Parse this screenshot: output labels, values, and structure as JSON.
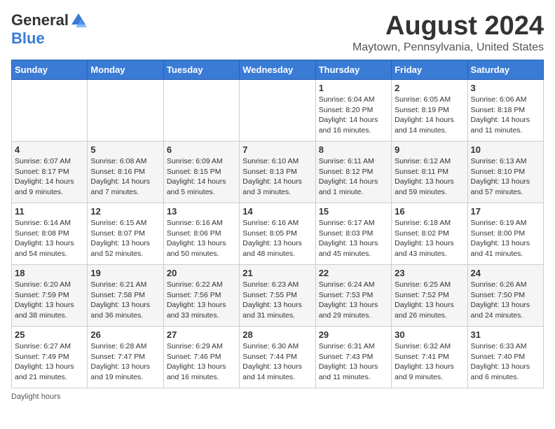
{
  "header": {
    "logo_general": "General",
    "logo_blue": "Blue",
    "month_title": "August 2024",
    "location": "Maytown, Pennsylvania, United States"
  },
  "weekdays": [
    "Sunday",
    "Monday",
    "Tuesday",
    "Wednesday",
    "Thursday",
    "Friday",
    "Saturday"
  ],
  "weeks": [
    [
      {
        "day": "",
        "info": ""
      },
      {
        "day": "",
        "info": ""
      },
      {
        "day": "",
        "info": ""
      },
      {
        "day": "",
        "info": ""
      },
      {
        "day": "1",
        "info": "Sunrise: 6:04 AM\nSunset: 8:20 PM\nDaylight: 14 hours\nand 16 minutes."
      },
      {
        "day": "2",
        "info": "Sunrise: 6:05 AM\nSunset: 8:19 PM\nDaylight: 14 hours\nand 14 minutes."
      },
      {
        "day": "3",
        "info": "Sunrise: 6:06 AM\nSunset: 8:18 PM\nDaylight: 14 hours\nand 11 minutes."
      }
    ],
    [
      {
        "day": "4",
        "info": "Sunrise: 6:07 AM\nSunset: 8:17 PM\nDaylight: 14 hours\nand 9 minutes."
      },
      {
        "day": "5",
        "info": "Sunrise: 6:08 AM\nSunset: 8:16 PM\nDaylight: 14 hours\nand 7 minutes."
      },
      {
        "day": "6",
        "info": "Sunrise: 6:09 AM\nSunset: 8:15 PM\nDaylight: 14 hours\nand 5 minutes."
      },
      {
        "day": "7",
        "info": "Sunrise: 6:10 AM\nSunset: 8:13 PM\nDaylight: 14 hours\nand 3 minutes."
      },
      {
        "day": "8",
        "info": "Sunrise: 6:11 AM\nSunset: 8:12 PM\nDaylight: 14 hours\nand 1 minute."
      },
      {
        "day": "9",
        "info": "Sunrise: 6:12 AM\nSunset: 8:11 PM\nDaylight: 13 hours\nand 59 minutes."
      },
      {
        "day": "10",
        "info": "Sunrise: 6:13 AM\nSunset: 8:10 PM\nDaylight: 13 hours\nand 57 minutes."
      }
    ],
    [
      {
        "day": "11",
        "info": "Sunrise: 6:14 AM\nSunset: 8:08 PM\nDaylight: 13 hours\nand 54 minutes."
      },
      {
        "day": "12",
        "info": "Sunrise: 6:15 AM\nSunset: 8:07 PM\nDaylight: 13 hours\nand 52 minutes."
      },
      {
        "day": "13",
        "info": "Sunrise: 6:16 AM\nSunset: 8:06 PM\nDaylight: 13 hours\nand 50 minutes."
      },
      {
        "day": "14",
        "info": "Sunrise: 6:16 AM\nSunset: 8:05 PM\nDaylight: 13 hours\nand 48 minutes."
      },
      {
        "day": "15",
        "info": "Sunrise: 6:17 AM\nSunset: 8:03 PM\nDaylight: 13 hours\nand 45 minutes."
      },
      {
        "day": "16",
        "info": "Sunrise: 6:18 AM\nSunset: 8:02 PM\nDaylight: 13 hours\nand 43 minutes."
      },
      {
        "day": "17",
        "info": "Sunrise: 6:19 AM\nSunset: 8:00 PM\nDaylight: 13 hours\nand 41 minutes."
      }
    ],
    [
      {
        "day": "18",
        "info": "Sunrise: 6:20 AM\nSunset: 7:59 PM\nDaylight: 13 hours\nand 38 minutes."
      },
      {
        "day": "19",
        "info": "Sunrise: 6:21 AM\nSunset: 7:58 PM\nDaylight: 13 hours\nand 36 minutes."
      },
      {
        "day": "20",
        "info": "Sunrise: 6:22 AM\nSunset: 7:56 PM\nDaylight: 13 hours\nand 33 minutes."
      },
      {
        "day": "21",
        "info": "Sunrise: 6:23 AM\nSunset: 7:55 PM\nDaylight: 13 hours\nand 31 minutes."
      },
      {
        "day": "22",
        "info": "Sunrise: 6:24 AM\nSunset: 7:53 PM\nDaylight: 13 hours\nand 29 minutes."
      },
      {
        "day": "23",
        "info": "Sunrise: 6:25 AM\nSunset: 7:52 PM\nDaylight: 13 hours\nand 26 minutes."
      },
      {
        "day": "24",
        "info": "Sunrise: 6:26 AM\nSunset: 7:50 PM\nDaylight: 13 hours\nand 24 minutes."
      }
    ],
    [
      {
        "day": "25",
        "info": "Sunrise: 6:27 AM\nSunset: 7:49 PM\nDaylight: 13 hours\nand 21 minutes."
      },
      {
        "day": "26",
        "info": "Sunrise: 6:28 AM\nSunset: 7:47 PM\nDaylight: 13 hours\nand 19 minutes."
      },
      {
        "day": "27",
        "info": "Sunrise: 6:29 AM\nSunset: 7:46 PM\nDaylight: 13 hours\nand 16 minutes."
      },
      {
        "day": "28",
        "info": "Sunrise: 6:30 AM\nSunset: 7:44 PM\nDaylight: 13 hours\nand 14 minutes."
      },
      {
        "day": "29",
        "info": "Sunrise: 6:31 AM\nSunset: 7:43 PM\nDaylight: 13 hours\nand 11 minutes."
      },
      {
        "day": "30",
        "info": "Sunrise: 6:32 AM\nSunset: 7:41 PM\nDaylight: 13 hours\nand 9 minutes."
      },
      {
        "day": "31",
        "info": "Sunrise: 6:33 AM\nSunset: 7:40 PM\nDaylight: 13 hours\nand 6 minutes."
      }
    ]
  ],
  "footer": {
    "note": "Daylight hours"
  }
}
